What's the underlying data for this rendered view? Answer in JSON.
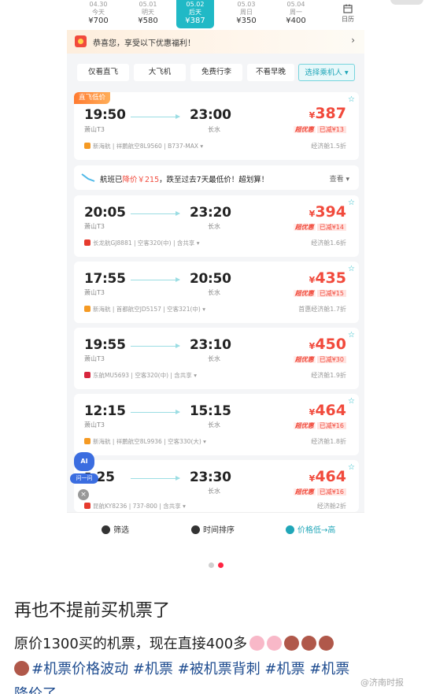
{
  "dates": [
    {
      "date": "04.30",
      "weekday": "今天",
      "price": "¥700",
      "active": false
    },
    {
      "date": "05.01",
      "weekday": "明天",
      "price": "¥580",
      "active": false
    },
    {
      "date": "05.02",
      "weekday": "后天",
      "price": "¥387",
      "active": true
    },
    {
      "date": "05.03",
      "weekday": "周日",
      "price": "¥350",
      "active": false
    },
    {
      "date": "05.04",
      "weekday": "周一",
      "price": "¥400",
      "active": false
    }
  ],
  "calendar_label": "日历",
  "promo": {
    "text": "恭喜您，享受以下优惠福利！",
    "arrow": "›"
  },
  "filters": [
    "仅看直飞",
    "大飞机",
    "免费行李",
    "不看早晚",
    "选择乘机人 ▾"
  ],
  "direct_tag": "直飞低价",
  "flights": [
    {
      "dep": "19:50",
      "arr": "23:00",
      "dep_airport": "萧山T3",
      "arr_airport": "长水",
      "airline": "新海航 | 祥鹏航空8L9560 | B737-MAX ▾",
      "price": "387",
      "discount": "超优惠",
      "saving": "已减¥13",
      "cabin": "经济舱1.5折",
      "logo_color": "#f59a23"
    },
    {
      "dep": "20:05",
      "arr": "23:20",
      "dep_airport": "萧山T3",
      "arr_airport": "长水",
      "airline": "长龙航GJ8881 | 空客320(中) | 含共享 ▾",
      "price": "394",
      "discount": "超优惠",
      "saving": "已减¥14",
      "cabin": "经济舱1.6折",
      "logo_color": "#e63b2e"
    },
    {
      "dep": "17:55",
      "arr": "20:50",
      "dep_airport": "萧山T3",
      "arr_airport": "长水",
      "airline": "新海航 | 首都航空JD5157 | 空客321(中) ▾",
      "price": "435",
      "discount": "超优惠",
      "saving": "已减¥15",
      "cabin": "首惠经济舱1.7折",
      "logo_color": "#f59a23"
    },
    {
      "dep": "19:55",
      "arr": "23:10",
      "dep_airport": "萧山T3",
      "arr_airport": "长水",
      "airline": "东航MU5693 | 空客320(中) | 含共享 ▾",
      "price": "450",
      "discount": "超优惠",
      "saving": "已减¥30",
      "cabin": "经济舱1.9折",
      "logo_color": "#d7263d"
    },
    {
      "dep": "12:15",
      "arr": "15:15",
      "dep_airport": "萧山T3",
      "arr_airport": "长水",
      "airline": "新海航 | 祥鹏航空8L9936 | 空客330(大) ▾",
      "price": "464",
      "discount": "超优惠",
      "saving": "已减¥16",
      "cabin": "经济舱1.8折",
      "logo_color": "#f59a23"
    },
    {
      "dep": "▮:25",
      "arr": "23:30",
      "dep_airport": "",
      "arr_airport": "长水",
      "airline": "昆航KY8236 | 737-800 | 含共享 ▾",
      "price": "464",
      "discount": "超优惠",
      "saving": "已减¥16",
      "cabin": "经济舱2折",
      "logo_color": "#e63b2e"
    }
  ],
  "notice": {
    "pre": "航班已",
    "highlight": "降价￥215",
    "post": "，跌至过去7天最低价！超划算！",
    "more": "查看 ▾"
  },
  "bottom_bar": {
    "filter": "筛选",
    "time_sort": "时间排序",
    "price_sort": "价格低→高"
  },
  "ai_assistant": {
    "badge": "AI",
    "label": "问一问",
    "close": "×"
  },
  "post": {
    "title": "再也不提前买机票了",
    "body": "原价1300买的机票，现在直接400多",
    "hashtags": "#机票价格波动 #机票 #被机票背刺 #机票 #机票",
    "tail": "降价了"
  },
  "watermark": "@济南时报",
  "colors": {
    "accent": "#20b9c6",
    "price": "#f14a3c",
    "hashtag": "#1d4b8f"
  }
}
